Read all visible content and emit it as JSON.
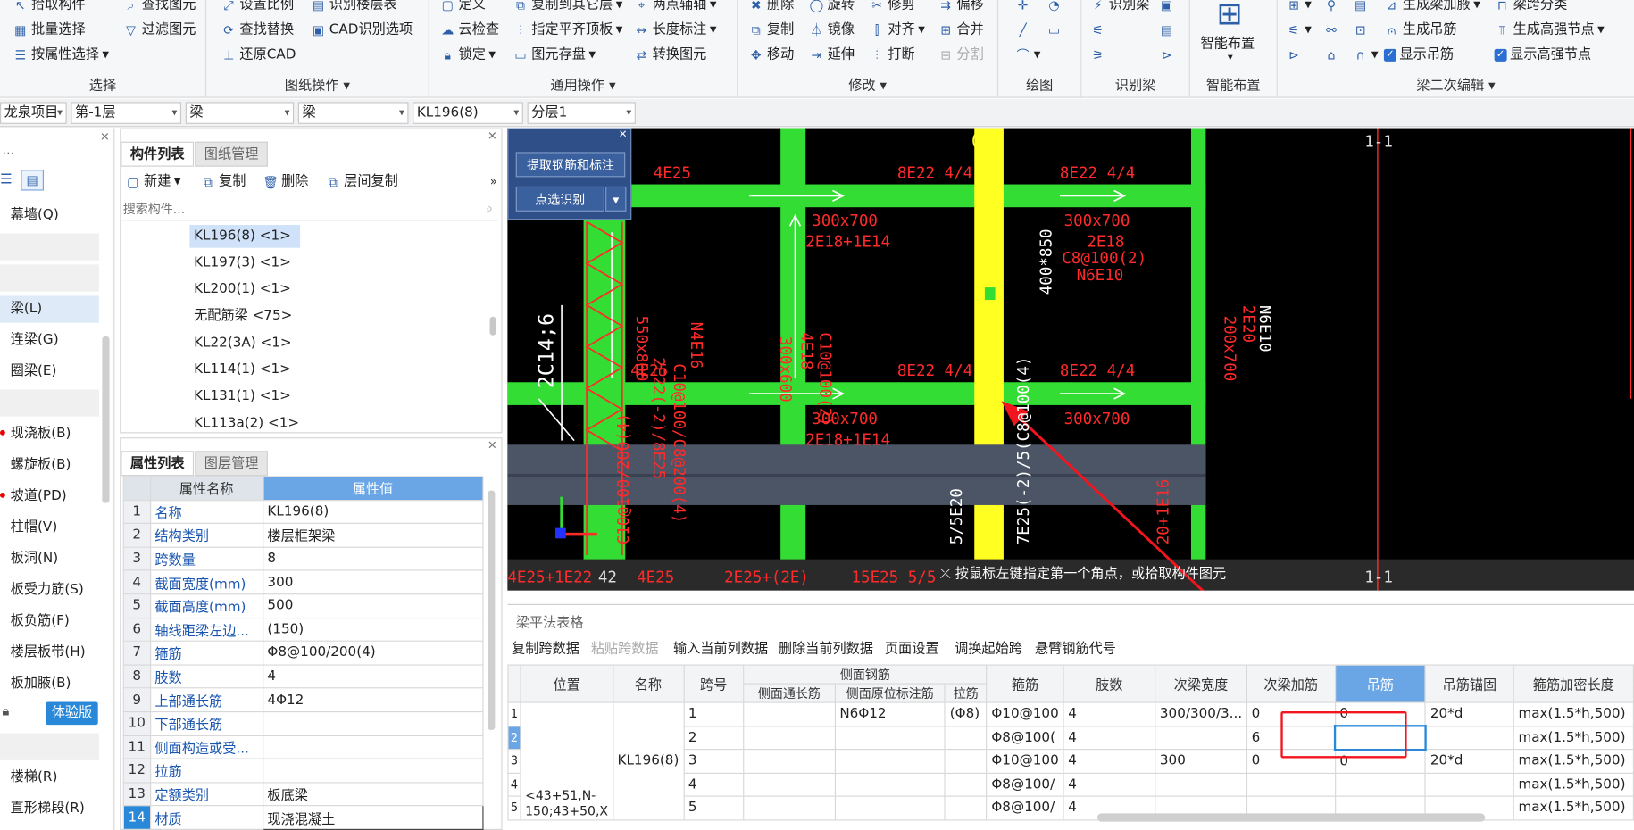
{
  "ribbon": {
    "select": {
      "title": "选择",
      "items": [
        "拾取构件",
        "批量选择",
        "按属性选择"
      ],
      "items2": [
        "查找图元",
        "过滤图元"
      ]
    },
    "drawing_ops": {
      "title": "图纸操作",
      "items": [
        "设置比例",
        "查找替换",
        "还原CAD"
      ],
      "items2": [
        "识别楼层表",
        "CAD识别选项"
      ]
    },
    "general_ops": {
      "title": "通用操作",
      "col1": [
        "定义",
        "云检查",
        "锁定"
      ],
      "col2": [
        "复制到其它层",
        "指定平齐顶板",
        "图元存盘"
      ],
      "col3": [
        "两点辅轴",
        "长度标注",
        "转换图元"
      ]
    },
    "modify": {
      "title": "修改",
      "col1": [
        "删除",
        "复制",
        "移动"
      ],
      "col2": [
        "旋转",
        "镜像",
        "延伸"
      ],
      "col3": [
        "修剪",
        "对齐",
        "打断"
      ],
      "col4": [
        "偏移",
        "合并",
        "分割"
      ]
    },
    "draw": {
      "title": "绘图"
    },
    "recognize_beam": {
      "title": "识别梁",
      "label": "识别梁"
    },
    "smart_layout": {
      "title": "智能布置",
      "label": "智能布置"
    },
    "beam_edit": {
      "title": "梁二次编辑",
      "col1": [
        "生成梁加腋",
        "生成吊筋",
        "显示吊筋"
      ],
      "col2": [
        "梁跨分类",
        "生成高强节点",
        "显示高强节点"
      ]
    }
  },
  "bar2": {
    "project": "龙泉项目",
    "floor": "第-1层",
    "category": "梁",
    "type": "梁",
    "component": "KL196(8)",
    "layer": "分层1"
  },
  "nav": {
    "partial_top": "…",
    "items": [
      "幕墙(Q)",
      "梁(L)",
      "连梁(G)",
      "圈梁(E)",
      "现浇板(B)",
      "螺旋板(B)",
      "坡道(PD)",
      "柱帽(V)",
      "板洞(N)",
      "板受力筋(S)",
      "板负筋(F)",
      "楼层板带(H)",
      "板加腋(B)",
      "楼梯(R)",
      "直形梯段(R)"
    ],
    "trial_badge": "体验版"
  },
  "comp": {
    "tabs": [
      "构件列表",
      "图纸管理"
    ],
    "tools": [
      "新建",
      "复制",
      "删除",
      "层间复制"
    ],
    "search_placeholder": "搜索构件...",
    "items": [
      "KL196(8) <1>",
      "KL197(3) <1>",
      "KL200(1) <1>",
      "无配筋梁 <75>",
      "KL22(3A) <1>",
      "KL114(1) <1>",
      "KL131(1) <1>",
      "KL113a(2) <1>"
    ]
  },
  "prop": {
    "tabs": [
      "属性列表",
      "图层管理"
    ],
    "header": {
      "name": "属性名称",
      "value": "属性值"
    },
    "rows": [
      {
        "n": "1",
        "k": "名称",
        "v": "KL196(8)"
      },
      {
        "n": "2",
        "k": "结构类别",
        "v": "楼层框架梁"
      },
      {
        "n": "3",
        "k": "跨数量",
        "v": "8"
      },
      {
        "n": "4",
        "k": "截面宽度(mm)",
        "v": "300"
      },
      {
        "n": "5",
        "k": "截面高度(mm)",
        "v": "500"
      },
      {
        "n": "6",
        "k": "轴线距梁左边...",
        "v": "(150)"
      },
      {
        "n": "7",
        "k": "箍筋",
        "v": "Φ8@100/200(4)"
      },
      {
        "n": "8",
        "k": "肢数",
        "v": "4"
      },
      {
        "n": "9",
        "k": "上部通长筋",
        "v": "4Φ12"
      },
      {
        "n": "10",
        "k": "下部通长筋",
        "v": ""
      },
      {
        "n": "11",
        "k": "侧面构造或受...",
        "v": ""
      },
      {
        "n": "12",
        "k": "拉筋",
        "v": ""
      },
      {
        "n": "13",
        "k": "定额类别",
        "v": "板底梁"
      },
      {
        "n": "14",
        "k": "材质",
        "v": "现浇混凝土"
      }
    ]
  },
  "popup": {
    "btn1": "提取钢筋和标注",
    "btn2": "点选识别"
  },
  "cad": {
    "status": "按鼠标左键指定第一个角点，或拾取构件图元",
    "labels": [
      "4E25",
      "8E22 4/4",
      "8E22 4/4",
      "300x700",
      "2E18+1E14",
      "300x700",
      "2E18",
      "C8@100(2)",
      "N6E10",
      "300x600",
      "4E18",
      "C10@100(2)",
      "550x800",
      "2E22(-2)/8E25",
      "C10@100/C8@200(4)",
      "N4E16",
      "4E25",
      "2C14;6",
      "8E22 4/4",
      "8E22 4/4",
      "300x700",
      "2E18+1E14",
      "300x700",
      "200x700",
      "2E20",
      "N6E10",
      "400*850",
      "43",
      "1-1",
      "1-1",
      "42",
      "5/5E20",
      "7E25(-2)/5(C8@100(4)",
      "4E25",
      "2E25+(2E)",
      "15E25 5/5",
      "4E25+1E22",
      "20+1E16",
      "C10@100/200(4)"
    ]
  },
  "grid": {
    "title": "梁平法表格",
    "tools": [
      "复制跨数据",
      "粘贴跨数据",
      "输入当前列数据",
      "删除当前列数据",
      "页面设置",
      "调换起始跨",
      "悬臂钢筋代号"
    ],
    "side_group": "侧面钢筋",
    "headers": [
      "位置",
      "名称",
      "跨号",
      "侧面通长筋",
      "侧面原位标注筋",
      "拉筋",
      "箍筋",
      "肢数",
      "次梁宽度",
      "次梁加筋",
      "吊筋",
      "吊筋锚固",
      "箍筋加密长度"
    ],
    "position_value": "<43+51,N-150;43+50,X",
    "name_value": "KL196(8)",
    "rows": [
      {
        "i": "1",
        "span": "1",
        "side_orig": "N6Φ12",
        "tie": "(Φ8)",
        "stirrup": "Φ10@100",
        "legs": "4",
        "sec_w": "300/300/3...",
        "sec_add": "0",
        "hanger": "0",
        "anchor": "20*d",
        "dense": "max(1.5*h,500)"
      },
      {
        "i": "2",
        "span": "2",
        "side_orig": "",
        "tie": "",
        "stirrup": "Φ8@100(",
        "legs": "4",
        "sec_w": "",
        "sec_add": "6",
        "hanger": "",
        "anchor": "",
        "dense": "max(1.5*h,500)"
      },
      {
        "i": "3",
        "span": "3",
        "side_orig": "",
        "tie": "",
        "stirrup": "Φ10@100",
        "legs": "4",
        "sec_w": "300",
        "sec_add": "0",
        "hanger": "0",
        "anchor": "20*d",
        "dense": "max(1.5*h,500)"
      },
      {
        "i": "4",
        "span": "4",
        "side_orig": "",
        "tie": "",
        "stirrup": "Φ8@100/",
        "legs": "4",
        "sec_w": "",
        "sec_add": "",
        "hanger": "",
        "anchor": "",
        "dense": "max(1.5*h,500)"
      },
      {
        "i": "5",
        "span": "5",
        "side_orig": "",
        "tie": "",
        "stirrup": "Φ8@100/",
        "legs": "4",
        "sec_w": "",
        "sec_add": "",
        "hanger": "",
        "anchor": "",
        "dense": "max(1.5*h,500)"
      }
    ]
  },
  "colors": {
    "accent": "#6aa6e6",
    "highlight_red": "#f2151e",
    "cad_green": "#33dd33",
    "cad_yellow": "#ffff22",
    "cad_red": "#ff2a2a"
  }
}
